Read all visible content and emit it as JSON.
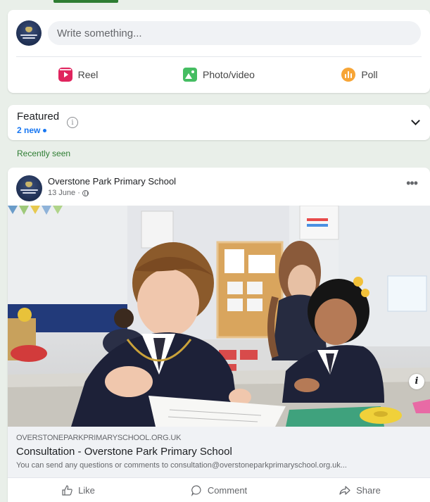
{
  "composer": {
    "placeholder": "Write something...",
    "actions": [
      {
        "label": "Reel",
        "icon": "reel-icon"
      },
      {
        "label": "Photo/video",
        "icon": "photo-icon"
      },
      {
        "label": "Poll",
        "icon": "poll-icon"
      }
    ]
  },
  "featured": {
    "title": "Featured",
    "new_label": "2 new"
  },
  "recently_seen_label": "Recently seen",
  "post": {
    "author": "Overstone Park Primary School",
    "date": "13 June ·",
    "link": {
      "domain": "OVERSTONEPARKPRIMARYSCHOOL.ORG.UK",
      "title": "Consultation - Overstone Park Primary School",
      "description": "You can send any questions or comments to consultation@overstoneparkprimaryschool.org.uk..."
    },
    "actions": [
      {
        "label": "Like",
        "icon": "like-icon"
      },
      {
        "label": "Comment",
        "icon": "comment-icon"
      },
      {
        "label": "Share",
        "icon": "share-icon"
      }
    ]
  },
  "colors": {
    "background": "#e9efe9",
    "accent_green": "#2e7d32",
    "link_blue": "#1877f2",
    "reel_red": "#e0245e",
    "photo_green": "#45bd62",
    "poll_orange": "#f7a536"
  }
}
